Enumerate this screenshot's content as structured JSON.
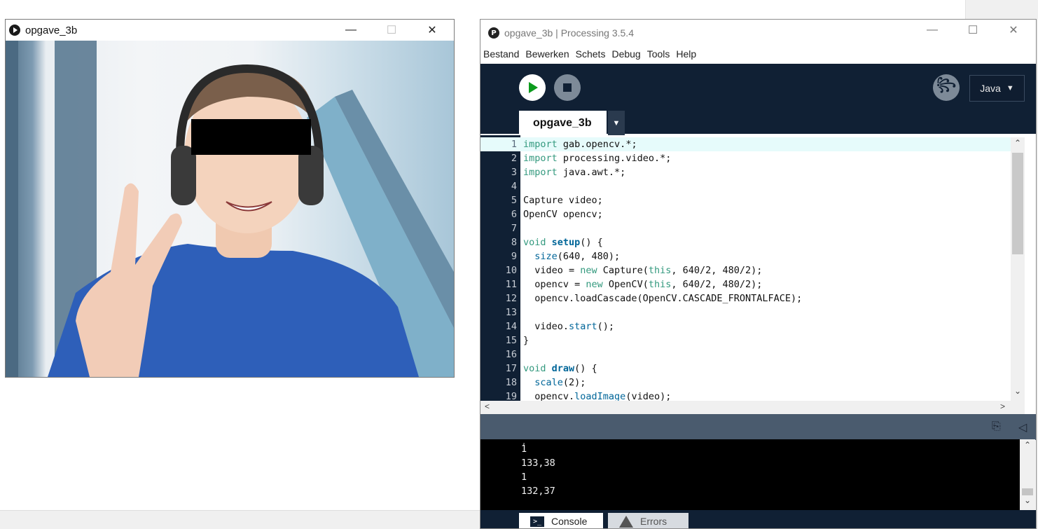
{
  "sketch_window": {
    "title": "opgave_3b",
    "minimize": "—",
    "maximize": "☐",
    "close": "✕"
  },
  "ide_window": {
    "title": "opgave_3b | Processing 3.5.4",
    "minimize": "—",
    "maximize": "☐",
    "close": "✕",
    "logo_glyph": "P",
    "menu": [
      "Bestand",
      "Bewerken",
      "Schets",
      "Debug",
      "Tools",
      "Help"
    ],
    "mode": "Java",
    "mode_arrow": "▼",
    "tab": "opgave_3b",
    "tab_menu_arrow": "▼",
    "debug_glyph": "꧂",
    "icons": {
      "run": "play-icon",
      "stop": "stop-icon",
      "debug": "debug-icon",
      "copy": "copy-icon",
      "collapse": "collapse-icon"
    },
    "code_lines": [
      [
        {
          "t": "import",
          "c": "kw"
        },
        {
          "t": " gab.opencv.*;"
        }
      ],
      [
        {
          "t": "import",
          "c": "kw"
        },
        {
          "t": " processing.video.*;"
        }
      ],
      [
        {
          "t": "import",
          "c": "kw"
        },
        {
          "t": " java.awt.*;"
        }
      ],
      [],
      [
        {
          "t": "Capture video;"
        }
      ],
      [
        {
          "t": "OpenCV opencv;"
        }
      ],
      [],
      [
        {
          "t": "void",
          "c": "kw"
        },
        {
          "t": " "
        },
        {
          "t": "setup",
          "c": "fnb"
        },
        {
          "t": "() {"
        }
      ],
      [
        {
          "t": "  "
        },
        {
          "t": "size",
          "c": "fn"
        },
        {
          "t": "(640, 480);"
        }
      ],
      [
        {
          "t": "  video = "
        },
        {
          "t": "new",
          "c": "kw"
        },
        {
          "t": " Capture("
        },
        {
          "t": "this",
          "c": "kw"
        },
        {
          "t": ", 640/2, 480/2);"
        }
      ],
      [
        {
          "t": "  opencv = "
        },
        {
          "t": "new",
          "c": "kw"
        },
        {
          "t": " OpenCV("
        },
        {
          "t": "this",
          "c": "kw"
        },
        {
          "t": ", 640/2, 480/2);"
        }
      ],
      [
        {
          "t": "  opencv.loadCascade(OpenCV.CASCADE_FRONTALFACE);"
        }
      ],
      [],
      [
        {
          "t": "  video."
        },
        {
          "t": "start",
          "c": "fn"
        },
        {
          "t": "();"
        }
      ],
      [
        {
          "t": "}"
        }
      ],
      [],
      [
        {
          "t": "void",
          "c": "kw"
        },
        {
          "t": " "
        },
        {
          "t": "draw",
          "c": "fnb"
        },
        {
          "t": "() {"
        }
      ],
      [
        {
          "t": "  "
        },
        {
          "t": "scale",
          "c": "fn"
        },
        {
          "t": "(2);"
        }
      ],
      [
        {
          "t": "  opencv."
        },
        {
          "t": "loadImage",
          "c": "fn"
        },
        {
          "t": "(video);"
        }
      ]
    ],
    "console_lines": [
      "1",
      "133,38",
      "1",
      "132,37"
    ],
    "console_tab": "Console",
    "errors_tab": "Errors",
    "console_glyph": ">_"
  }
}
